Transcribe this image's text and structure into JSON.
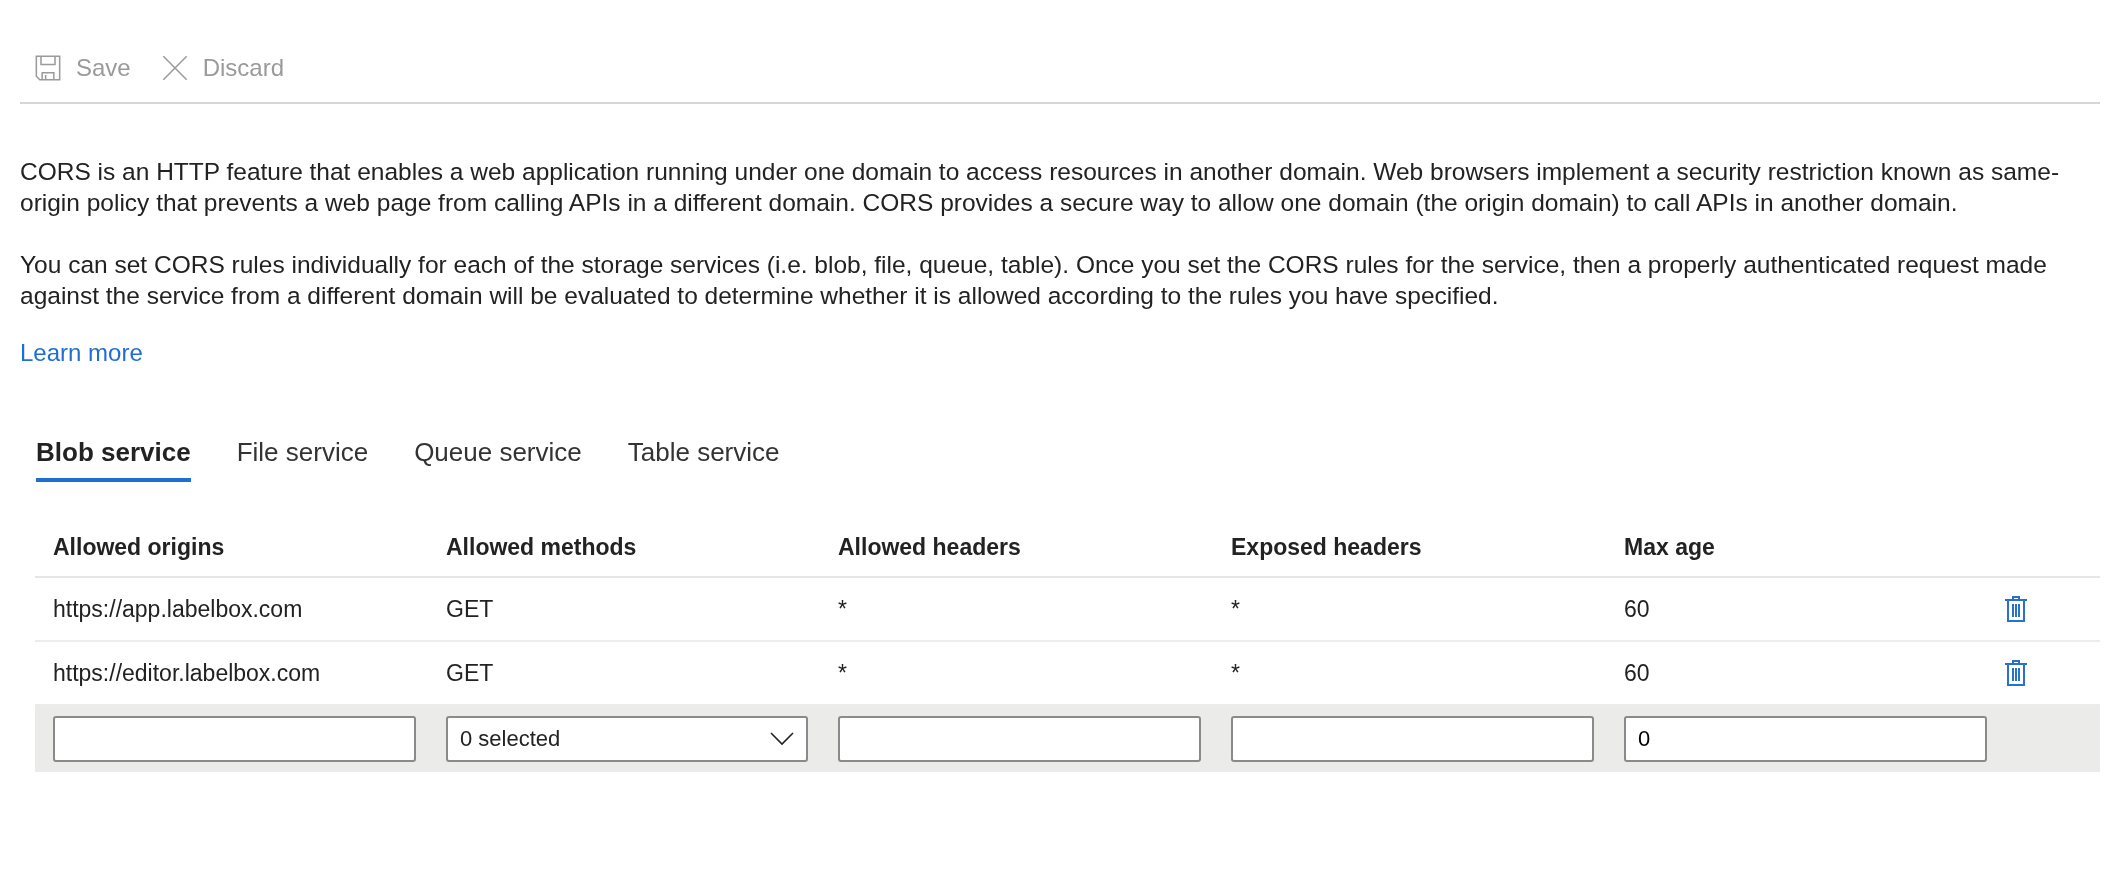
{
  "toolbar": [
    {
      "kind": "save",
      "label": "Save",
      "disabled": true
    },
    {
      "kind": "discard",
      "label": "Discard",
      "disabled": true
    }
  ],
  "description": [
    "CORS is an HTTP feature that enables a web application running under one domain to access resources in another domain. Web browsers implement a security restriction known as same-origin policy that prevents a web page from calling APIs in a different domain. CORS provides a secure way to allow one domain (the origin domain) to call APIs in another domain.",
    "You can set CORS rules individually for each of the storage services (i.e. blob, file, queue, table). Once you set the CORS rules for the service, then a properly authenticated request made against the service from a different domain will be evaluated to determine whether it is allowed according to the rules you have specified."
  ],
  "learn_more": "Learn more",
  "tabs": [
    {
      "label": "Blob service",
      "selected": true
    },
    {
      "label": "File service",
      "selected": false
    },
    {
      "label": "Queue service",
      "selected": false
    },
    {
      "label": "Table service",
      "selected": false
    }
  ],
  "table": {
    "columns": [
      "Allowed origins",
      "Allowed methods",
      "Allowed headers",
      "Exposed headers",
      "Max age"
    ],
    "rows": [
      [
        "https://app.labelbox.com",
        "GET",
        "*",
        "*",
        "60"
      ],
      [
        "https://editor.labelbox.com",
        "GET",
        "*",
        "*",
        "60"
      ]
    ],
    "new_row": [
      {
        "kind": "text"
      },
      {
        "kind": "select",
        "value": "0 selected"
      },
      {
        "kind": "text"
      },
      {
        "kind": "text"
      },
      {
        "kind": "text",
        "value": "0"
      }
    ]
  }
}
